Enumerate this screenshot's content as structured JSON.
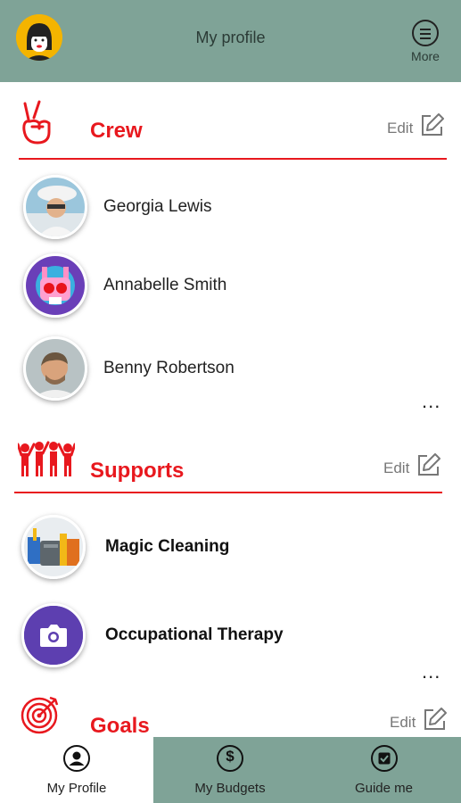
{
  "header": {
    "title": "My profile",
    "more_label": "More"
  },
  "crew": {
    "title": "Crew",
    "edit_label": "Edit",
    "members": [
      {
        "name": "Georgia Lewis"
      },
      {
        "name": "Annabelle Smith"
      },
      {
        "name": "Benny Robertson"
      }
    ],
    "more": "..."
  },
  "supports": {
    "title": "Supports",
    "edit_label": "Edit",
    "items": [
      {
        "name": "Magic Cleaning"
      },
      {
        "name": "Occupational Therapy"
      }
    ],
    "more": "..."
  },
  "goals": {
    "title": "Goals",
    "edit_label": "Edit"
  },
  "bottom_nav": {
    "tabs": [
      {
        "label": "My Profile",
        "active": true
      },
      {
        "label": "My Budgets",
        "active": false
      },
      {
        "label": "Guide me",
        "active": false
      }
    ]
  },
  "colors": {
    "header_bg": "#7fa397",
    "accent": "#e8181e",
    "active_tab_bg": "#ffffff",
    "inactive_tab_bg": "#7fa397",
    "therapy_icon_bg": "#5d3fb0"
  },
  "icons": {
    "crew": "peace-hand-icon",
    "supports": "group-people-icon",
    "goals": "target-icon",
    "edit": "edit-pencil-icon",
    "more": "hamburger-menu-icon",
    "therapy": "camera-icon"
  }
}
